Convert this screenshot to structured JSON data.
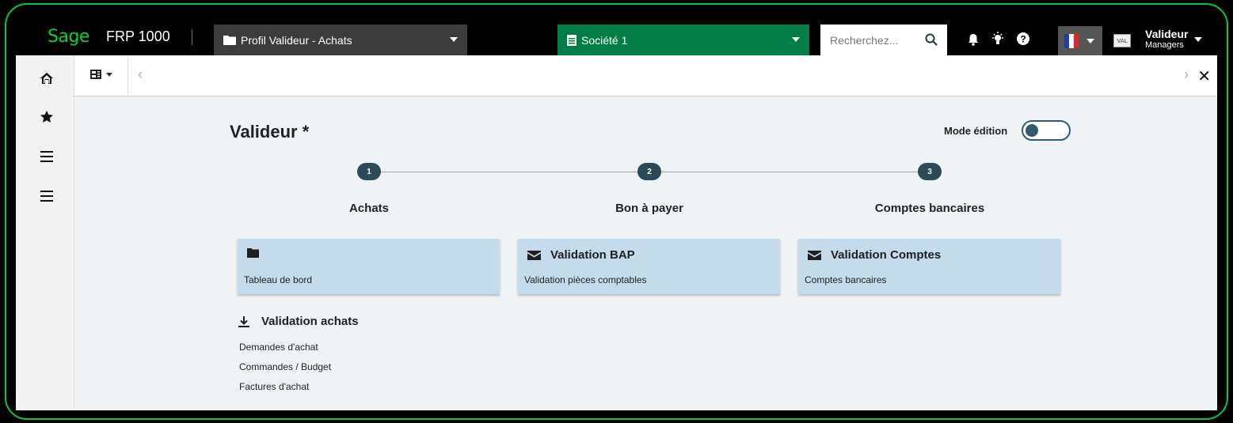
{
  "app": {
    "logo": "Sage",
    "name": "FRP 1000"
  },
  "header": {
    "profile": "Profil Valideur - Achats",
    "company": "Société 1",
    "search_placeholder": "Recherchez...",
    "avatar_text": "VAL",
    "user_name": "Valideur",
    "user_role": "Managers"
  },
  "page": {
    "title": "Valideur *",
    "mode_label": "Mode édition",
    "mode_enabled": false
  },
  "steps": [
    {
      "number": "1",
      "label": "Achats"
    },
    {
      "number": "2",
      "label": "Bon à payer"
    },
    {
      "number": "3",
      "label": "Comptes bancaires"
    }
  ],
  "cards": [
    {
      "icon": "folder-icon",
      "title": "",
      "description": "Tableau de bord"
    },
    {
      "icon": "envelope-icon",
      "title": "Validation BAP",
      "description": "Validation pièces comptables"
    },
    {
      "icon": "envelope-icon",
      "title": "Validation Comptes",
      "description": "Comptes bancaires"
    }
  ],
  "section": {
    "icon": "download-icon",
    "title": "Validation achats",
    "links": [
      "Demandes d'achat",
      "Commandes / Budget",
      "Factures d'achat"
    ]
  },
  "colors": {
    "accent_green": "#007e45",
    "card_bg": "#c3dbea",
    "step_dot": "#2d4a5b",
    "frame_border": "#00c853"
  }
}
